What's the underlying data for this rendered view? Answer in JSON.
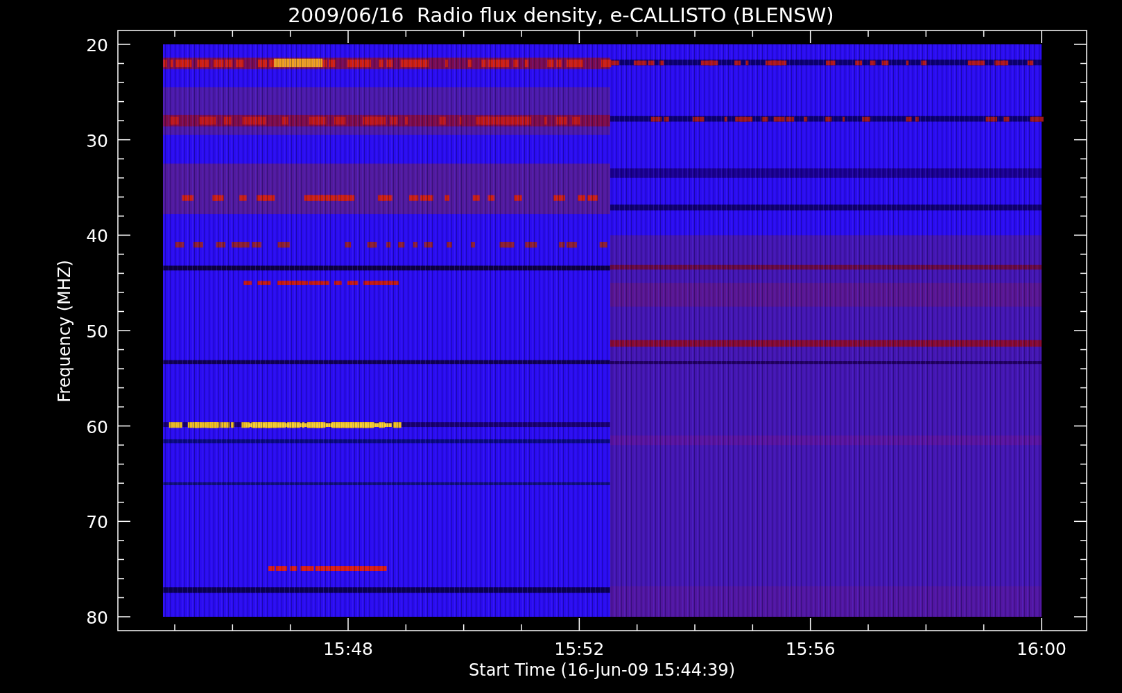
{
  "title": "2009/06/16  Radio flux density, e-CALLISTO (BLENSW)",
  "y_axis": {
    "label": "Frequency (MHZ)",
    "ticks": [
      "20",
      "30",
      "40",
      "50",
      "60",
      "70",
      "80"
    ]
  },
  "x_axis": {
    "label": "Start Time (16-Jun-09 15:44:39)",
    "ticks": [
      "15:48",
      "15:52",
      "15:56",
      "16:00"
    ]
  }
}
